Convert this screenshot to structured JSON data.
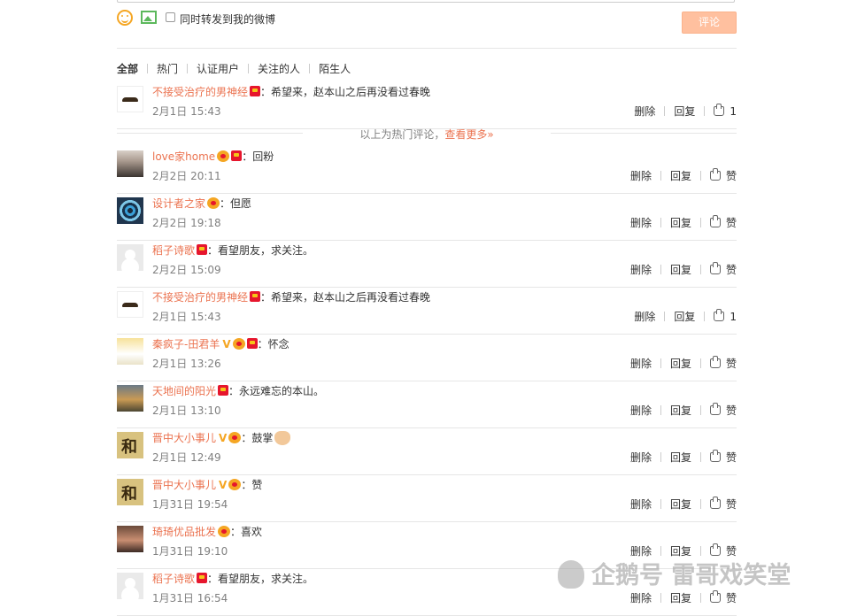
{
  "composer": {
    "forward_label": "同时转发到我的微博",
    "submit_label": "评论",
    "icons": [
      "smiley-icon",
      "image-icon"
    ]
  },
  "filter_tabs": [
    "全部",
    "热门",
    "认证用户",
    "关注的人",
    "陌生人"
  ],
  "hot_separator": {
    "text": "以上为热门评论，",
    "more": "查看更多»"
  },
  "actions": {
    "delete": "删除",
    "reply": "回复",
    "like": "赞"
  },
  "hot_comments": [
    {
      "name": "不接受治疗的男神经",
      "text": "：希望来，赵本山之后再没看过春晚",
      "time": "2月1日 15:43",
      "likes": "1",
      "avatar": "mustache"
    }
  ],
  "comments": [
    {
      "name": "love家home",
      "text": "：回粉",
      "time": "2月2日 20:11",
      "likes": "赞",
      "avatar": "woman",
      "medal": true,
      "badge": true
    },
    {
      "name": "设计者之家",
      "text": "：但愿",
      "time": "2月2日 19:18",
      "likes": "赞",
      "avatar": "spiral",
      "medal": true
    },
    {
      "name": "稻子诗歌",
      "text": "：看望朋友，求关注。",
      "time": "2月2日 15:09",
      "likes": "赞",
      "avatar": "default",
      "badge": true
    },
    {
      "name": "不接受治疗的男神经",
      "text": "：希望来，赵本山之后再没看过春晚",
      "time": "2月1日 15:43",
      "likes": "1",
      "avatar": "mustache",
      "badge": true
    },
    {
      "name": "秦疯子-田君羊",
      "text": "：怀念",
      "time": "2月1日 13:26",
      "likes": "赞",
      "avatar": "bee",
      "vip": true,
      "medal": true,
      "badge": true
    },
    {
      "name": "天地间的阳光",
      "text": "：永远难忘的本山。",
      "time": "2月1日 13:10",
      "likes": "赞",
      "avatar": "sunset",
      "badge": true
    },
    {
      "name": "晋中大小事儿",
      "text": "：鼓掌",
      "time": "2月1日 12:49",
      "likes": "赞",
      "avatar": "he",
      "vip": true,
      "medal": true,
      "emoji": true
    },
    {
      "name": "晋中大小事儿",
      "text": "：赞",
      "time": "1月31日 19:54",
      "likes": "赞",
      "avatar": "he",
      "vip": true,
      "medal": true
    },
    {
      "name": "琦琦优品批发",
      "text": "：喜欢",
      "time": "1月31日 19:10",
      "likes": "赞",
      "avatar": "girl",
      "medal": true
    },
    {
      "name": "稻子诗歌",
      "text": "：看望朋友，求关注。",
      "time": "1月31日 16:54",
      "likes": "赞",
      "avatar": "default",
      "badge": true
    }
  ],
  "watermark": "企鹅号 雷哥戏笑堂",
  "colors": {
    "name": "#eb7350",
    "submit": "#ffc09f",
    "line": "#e6e6e6",
    "time": "#808080"
  }
}
